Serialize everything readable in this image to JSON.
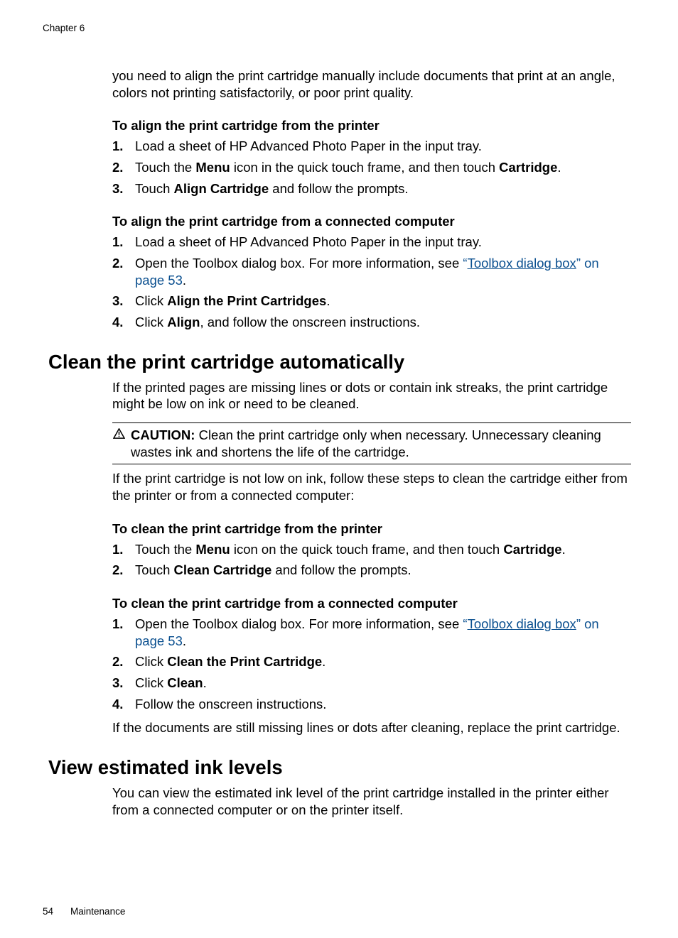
{
  "header": {
    "chapter": "Chapter 6"
  },
  "intro": {
    "text": "you need to align the print cartridge manually include documents that print at an angle, colors not printing satisfactorily, or poor print quality."
  },
  "alignPrinter": {
    "heading": "To align the print cartridge from the printer",
    "steps": {
      "s1": "Load a sheet of HP Advanced Photo Paper in the input tray.",
      "s2a": "Touch the ",
      "s2b": "Menu",
      "s2c": " icon in the quick touch frame, and then touch ",
      "s2d": "Cartridge",
      "s2e": ".",
      "s3a": "Touch ",
      "s3b": "Align Cartridge",
      "s3c": " and follow the prompts."
    }
  },
  "alignComputer": {
    "heading": "To align the print cartridge from a connected computer",
    "steps": {
      "s1": "Load a sheet of HP Advanced Photo Paper in the input tray.",
      "s2a": "Open the Toolbox dialog box. For more information, see ",
      "s2b": "“",
      "s2c": "Toolbox dialog box",
      "s2d": "” on page 53",
      "s2e": ".",
      "s3a": "Click ",
      "s3b": "Align the Print Cartridges",
      "s3c": ".",
      "s4a": "Click ",
      "s4b": "Align",
      "s4c": ", and follow the onscreen instructions."
    }
  },
  "cleanSection": {
    "heading": "Clean the print cartridge automatically",
    "para1": "If the printed pages are missing lines or dots or contain ink streaks, the print cartridge might be low on ink or need to be cleaned.",
    "caution": {
      "label": "CAUTION:",
      "text": "  Clean the print cartridge only when necessary. Unnecessary cleaning wastes ink and shortens the life of the cartridge."
    },
    "para2": "If the print cartridge is not low on ink, follow these steps to clean the cartridge either from the printer or from a connected computer:"
  },
  "cleanPrinter": {
    "heading": "To clean the print cartridge from the printer",
    "steps": {
      "s1a": "Touch the ",
      "s1b": "Menu",
      "s1c": " icon on the quick touch frame, and then touch ",
      "s1d": "Cartridge",
      "s1e": ".",
      "s2a": "Touch ",
      "s2b": "Clean Cartridge",
      "s2c": " and follow the prompts."
    }
  },
  "cleanComputer": {
    "heading": "To clean the print cartridge from a connected computer",
    "steps": {
      "s1a": "Open the Toolbox dialog box. For more information, see ",
      "s1b": "“",
      "s1c": "Toolbox dialog box",
      "s1d": "” on page 53",
      "s1e": ".",
      "s2a": "Click ",
      "s2b": "Clean the Print Cartridge",
      "s2c": ".",
      "s3a": "Click ",
      "s3b": "Clean",
      "s3c": ".",
      "s4": "Follow the onscreen instructions."
    },
    "after": "If the documents are still missing lines or dots after cleaning, replace the print cartridge."
  },
  "viewInk": {
    "heading": "View estimated ink levels",
    "para": "You can view the estimated ink level of the print cartridge installed in the printer either from a connected computer or on the printer itself."
  },
  "footer": {
    "page": "54",
    "section": "Maintenance"
  }
}
